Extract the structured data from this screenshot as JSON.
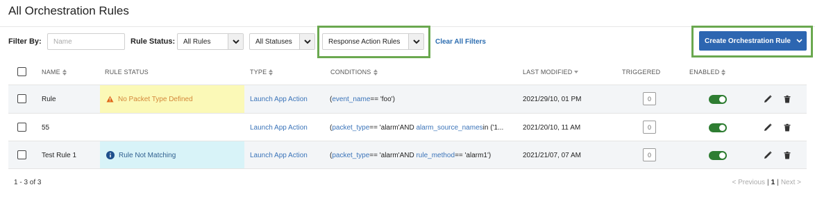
{
  "page": {
    "title": "All Orchestration Rules"
  },
  "filters": {
    "filter_by_label": "Filter By:",
    "name_placeholder": "Name",
    "rule_status_label": "Rule Status:",
    "rule_status_value": "All Rules",
    "statuses_value": "All Statuses",
    "action_type_value": "Response Action Rules",
    "clear_label": "Clear All Filters"
  },
  "create_button": {
    "label": "Create Orchestration Rule"
  },
  "table": {
    "headers": {
      "name": "NAME",
      "rule_status": "RULE STATUS",
      "type": "TYPE",
      "conditions": "CONDITIONS",
      "last_modified": "LAST MODIFIED",
      "triggered": "TRIGGERED",
      "enabled": "ENABLED"
    },
    "rows": [
      {
        "name": "Rule",
        "status": "No Packet Type Defined",
        "type": "Launch App Action",
        "cond": {
          "t1": "event_name",
          "v1": " == 'foo')"
        },
        "modified": "2021/29/10, 01 PM",
        "triggered": "0",
        "enabled": true
      },
      {
        "name": "55",
        "status": "",
        "type": "Launch App Action",
        "cond": {
          "t1": "packet_type",
          "v1": " == 'alarm' ",
          "and": "AND",
          "t2": "alarm_source_names",
          "v2": " in ('1..."
        },
        "modified": "2021/20/10, 11 AM",
        "triggered": "0",
        "enabled": true
      },
      {
        "name": "Test Rule 1",
        "status": "Rule Not Matching",
        "type": "Launch App Action",
        "cond": {
          "t1": "packet_type",
          "v1": " == 'alarm' ",
          "and": "AND",
          "t2": "rule_method",
          "v2": " == 'alarm1')"
        },
        "modified": "2021/21/07, 07 AM",
        "triggered": "0",
        "enabled": true
      }
    ]
  },
  "footer": {
    "count": "1 - 3 of 3",
    "prev": "< Previous",
    "page": "1",
    "next": "Next >"
  },
  "colors": {
    "accent": "#2d66b1",
    "highlight_box": "#6aa84f",
    "enabled_toggle": "#2e7d32",
    "warn_bg": "#fbf9b7",
    "info_bg": "#d8f3f8"
  }
}
